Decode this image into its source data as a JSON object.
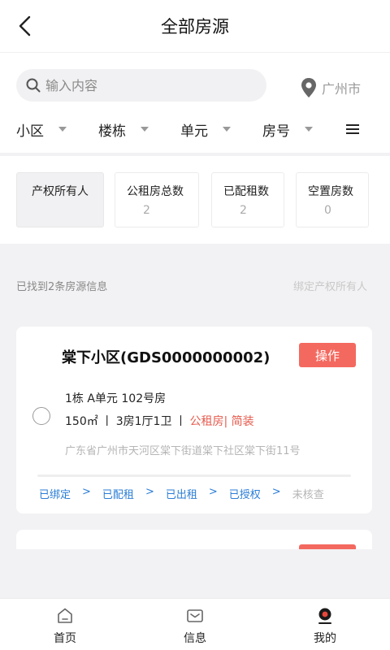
{
  "header": {
    "title": "全部房源"
  },
  "search": {
    "placeholder": "输入内容",
    "city": "广州市"
  },
  "filters": [
    {
      "label": "小区"
    },
    {
      "label": "楼栋"
    },
    {
      "label": "单元"
    },
    {
      "label": "房号"
    }
  ],
  "stats": {
    "owner": {
      "label": "产权所有人"
    },
    "items": [
      {
        "label": "公租房总数",
        "value": "2"
      },
      {
        "label": "已配租数",
        "value": "2"
      },
      {
        "label": "空置房数",
        "value": "0"
      }
    ]
  },
  "summary": {
    "found": "已找到2条房源信息",
    "bind_owner": "绑定产权所有人"
  },
  "listing": {
    "title": "棠下小区(GDS0000000002)",
    "action_label": "操作",
    "unit": "1栋 A单元 102号房",
    "area": "150㎡",
    "layout": "3房1厅1卫",
    "tags": "公租房| 简装",
    "separator": "丨",
    "address": "广东省广州市天河区棠下街道棠下社区棠下街11号",
    "steps": [
      {
        "label": "已绑定",
        "done": true
      },
      {
        "label": "已配租",
        "done": true
      },
      {
        "label": "已出租",
        "done": true
      },
      {
        "label": "已授权",
        "done": true
      },
      {
        "label": "未核查",
        "done": false
      }
    ],
    "step_arrow": ">"
  },
  "tabs": [
    {
      "label": "首页",
      "icon": "home-icon"
    },
    {
      "label": "信息",
      "icon": "mail-icon"
    },
    {
      "label": "我的",
      "icon": "user-icon"
    }
  ],
  "colors": {
    "accent_red": "#f4695f",
    "link_blue": "#2a7dd6"
  }
}
